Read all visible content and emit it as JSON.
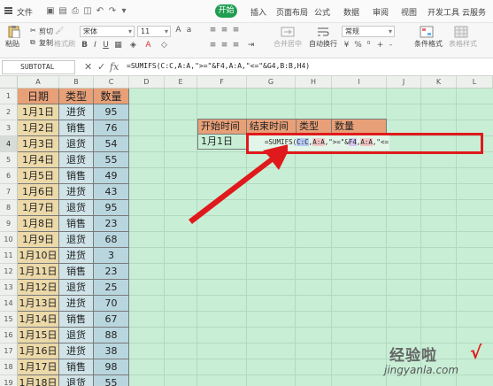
{
  "menu": {
    "file_label": "文件",
    "tabs": [
      "开始",
      "插入",
      "页面布局",
      "公式",
      "数据",
      "审阅",
      "视图",
      "开发工具",
      "云服务"
    ],
    "active_tab": "开始"
  },
  "ribbon": {
    "paste_label": "粘贴",
    "cut_label": "剪切",
    "copy_label": "复制",
    "format_painter_label": "格式刷",
    "font_name": "宋体",
    "font_size": "11",
    "merge_label": "合并居中",
    "wrap_label": "自动换行",
    "number_format": "常规",
    "cond_format_label": "条件格式",
    "table_style_label": "表格样式"
  },
  "formula_bar": {
    "name_box": "SUBTOTAL",
    "cancel_icon": "✕",
    "confirm_icon": "✓",
    "fx_label": "fx",
    "formula": "=SUMIFS(C:C,A:A,\">=\"&F4,A:A,\"<=\"&G4,B:B,H4)"
  },
  "columns": [
    "A",
    "B",
    "C",
    "D",
    "E",
    "F",
    "G",
    "H",
    "I",
    "J",
    "K",
    "L"
  ],
  "rows": [
    "1",
    "2",
    "3",
    "4",
    "5",
    "6",
    "7",
    "8",
    "9",
    "10",
    "11",
    "12",
    "13",
    "14",
    "15",
    "16",
    "17",
    "18",
    "19"
  ],
  "table_headers": [
    "日期",
    "类型",
    "数量"
  ],
  "table_rows": [
    [
      "1月1日",
      "进货",
      "95"
    ],
    [
      "1月2日",
      "销售",
      "76"
    ],
    [
      "1月3日",
      "退货",
      "54"
    ],
    [
      "1月4日",
      "退货",
      "55"
    ],
    [
      "1月5日",
      "销售",
      "49"
    ],
    [
      "1月6日",
      "进货",
      "43"
    ],
    [
      "1月7日",
      "退货",
      "95"
    ],
    [
      "1月8日",
      "销售",
      "23"
    ],
    [
      "1月9日",
      "退货",
      "68"
    ],
    [
      "1月10日",
      "进货",
      "3"
    ],
    [
      "1月11日",
      "销售",
      "23"
    ],
    [
      "1月12日",
      "退货",
      "25"
    ],
    [
      "1月13日",
      "进货",
      "70"
    ],
    [
      "1月14日",
      "销售",
      "67"
    ],
    [
      "1月15日",
      "退货",
      "88"
    ],
    [
      "1月16日",
      "进货",
      "38"
    ],
    [
      "1月17日",
      "销售",
      "98"
    ],
    [
      "1月18日",
      "退货",
      "55"
    ]
  ],
  "criteria_headers": [
    "开始时间",
    "结束时间",
    "类型",
    "数量"
  ],
  "criteria_start_value": "1月1日",
  "editing_formula_parts": [
    "=SUMIFS(",
    "C:C",
    ",",
    "A:A",
    ",\">=\"&",
    "F4",
    ",",
    "A:A",
    ",\"<=\"&",
    "G4",
    ",",
    "B:B",
    ",",
    "H4",
    ")"
  ],
  "watermark": {
    "title": "经验啦",
    "check": "√",
    "url": "jingyanla.com"
  },
  "colors": {
    "active_tab": "#1f9e51",
    "sheet_bg": "#c8efd6",
    "header_fill": "#e8a078",
    "date_fill": "#ecd9a9",
    "type_fill": "#cfe3e8",
    "qty_fill": "#b9d6de",
    "highlight_box": "#e0191c",
    "arrow": "#e0191c"
  }
}
